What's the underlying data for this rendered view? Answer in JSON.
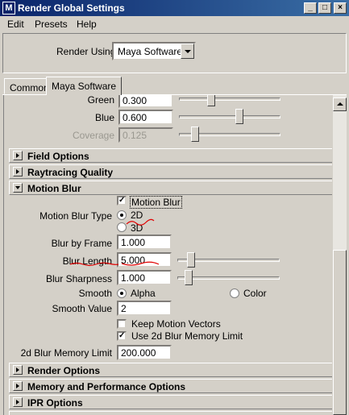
{
  "window": {
    "title": "Render Global Settings",
    "app_icon": "M",
    "minimize_glyph": "_",
    "maximize_glyph": "□",
    "close_glyph": "×"
  },
  "menu": [
    "Edit",
    "Presets",
    "Help"
  ],
  "render_using": {
    "label": "Render Using",
    "value": "Maya Software"
  },
  "tabs": [
    {
      "label": "Common",
      "active": false
    },
    {
      "label": "Maya Software",
      "active": true
    }
  ],
  "color_rows": [
    {
      "label": "Green",
      "value": "0.300",
      "slider_fraction": 0.3,
      "dimmed": false
    },
    {
      "label": "Blue",
      "value": "0.600",
      "slider_fraction": 0.6,
      "dimmed": false
    },
    {
      "label": "Coverage",
      "value": "0.125",
      "slider_fraction": 0.125,
      "dimmed": true
    }
  ],
  "sections_top": [
    {
      "title": "Field Options",
      "expanded": false
    },
    {
      "title": "Raytracing Quality",
      "expanded": false
    }
  ],
  "motion_blur": {
    "title": "Motion Blur",
    "enable_label": "Motion Blur",
    "enable_checked": true,
    "type_label": "Motion Blur Type",
    "type_options": [
      "2D",
      "3D"
    ],
    "type_selected": "2D",
    "blur_by_frame": {
      "label": "Blur by Frame",
      "value": "1.000"
    },
    "blur_length": {
      "label": "Blur Length",
      "value": "5.000",
      "slider_fraction": 0.1
    },
    "blur_sharpness": {
      "label": "Blur Sharpness",
      "value": "1.000",
      "slider_fraction": 0.08
    },
    "smooth": {
      "label": "Smooth",
      "options": [
        "Alpha",
        "Color"
      ],
      "selected": "Alpha"
    },
    "smooth_value": {
      "label": "Smooth Value",
      "value": "2"
    },
    "keep_motion_vectors": {
      "label": "Keep Motion Vectors",
      "checked": false
    },
    "use_2d_blur_memory_limit": {
      "label": "Use 2d Blur Memory Limit",
      "checked": true
    },
    "blur_memory_limit": {
      "label": "2d Blur Memory Limit",
      "value": "200.000"
    }
  },
  "sections_bottom": [
    {
      "title": "Render Options",
      "expanded": false
    },
    {
      "title": "Memory and Performance Options",
      "expanded": false
    },
    {
      "title": "IPR Options",
      "expanded": false
    }
  ],
  "colors": {
    "titlebar": "#0a246a",
    "panel": "#d4d0c8",
    "annotation": "#e00000"
  }
}
